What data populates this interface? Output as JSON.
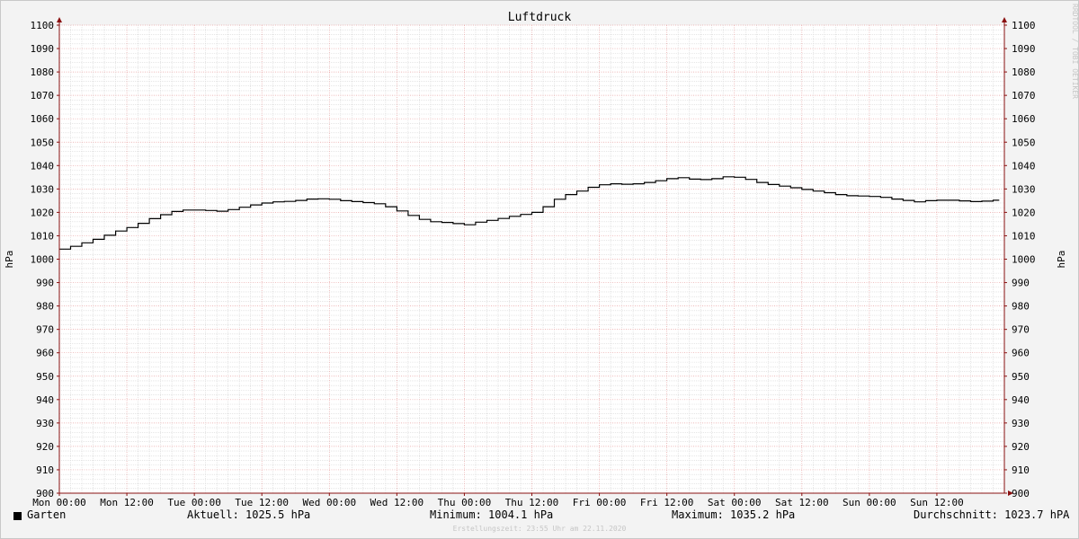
{
  "chart_data": {
    "type": "line",
    "title": "Luftdruck",
    "ylabel": "hPa",
    "ylabel_right": "hPa",
    "ylim": [
      900,
      1100
    ],
    "y_ticks": [
      900,
      910,
      920,
      930,
      940,
      950,
      960,
      970,
      980,
      990,
      1000,
      1010,
      1020,
      1030,
      1040,
      1050,
      1060,
      1070,
      1080,
      1090,
      1100
    ],
    "xlim": [
      0,
      168
    ],
    "x_ticks": [
      {
        "t": 0,
        "label": "Mon 00:00"
      },
      {
        "t": 12,
        "label": "Mon 12:00"
      },
      {
        "t": 24,
        "label": "Tue 00:00"
      },
      {
        "t": 36,
        "label": "Tue 12:00"
      },
      {
        "t": 48,
        "label": "Wed 00:00"
      },
      {
        "t": 60,
        "label": "Wed 12:00"
      },
      {
        "t": 72,
        "label": "Thu 00:00"
      },
      {
        "t": 84,
        "label": "Thu 12:00"
      },
      {
        "t": 96,
        "label": "Fri 00:00"
      },
      {
        "t": 108,
        "label": "Fri 12:00"
      },
      {
        "t": 120,
        "label": "Sat 00:00"
      },
      {
        "t": 132,
        "label": "Sat 12:00"
      },
      {
        "t": 144,
        "label": "Sun 00:00"
      },
      {
        "t": 156,
        "label": "Sun 12:00"
      }
    ],
    "grid": true,
    "series": [
      {
        "name": "Garten",
        "color": "#000000",
        "x": [
          0,
          2,
          4,
          6,
          8,
          10,
          12,
          14,
          16,
          18,
          20,
          22,
          24,
          26,
          28,
          30,
          32,
          34,
          36,
          38,
          40,
          42,
          44,
          46,
          48,
          50,
          52,
          54,
          56,
          58,
          60,
          62,
          64,
          66,
          68,
          70,
          72,
          74,
          76,
          78,
          80,
          82,
          84,
          86,
          88,
          90,
          92,
          94,
          96,
          98,
          100,
          102,
          104,
          106,
          108,
          110,
          112,
          114,
          116,
          118,
          120,
          122,
          124,
          126,
          128,
          130,
          132,
          134,
          136,
          138,
          140,
          142,
          144,
          146,
          148,
          150,
          152,
          154,
          156,
          158,
          160,
          162,
          164,
          166,
          167
        ],
        "y": [
          1004.3,
          1005.5,
          1007.0,
          1008.5,
          1010.2,
          1012.0,
          1013.5,
          1015.3,
          1017.3,
          1019.0,
          1020.4,
          1021.0,
          1021.0,
          1020.8,
          1020.5,
          1021.2,
          1022.2,
          1023.2,
          1024.0,
          1024.5,
          1024.7,
          1025.1,
          1025.7,
          1025.8,
          1025.6,
          1025.0,
          1024.6,
          1024.2,
          1023.7,
          1022.4,
          1020.6,
          1018.7,
          1017.0,
          1016.0,
          1015.7,
          1015.2,
          1014.7,
          1015.8,
          1016.6,
          1017.4,
          1018.3,
          1019.1,
          1020.0,
          1022.4,
          1025.6,
          1027.6,
          1029.1,
          1030.7,
          1031.8,
          1032.2,
          1032.0,
          1032.2,
          1032.8,
          1033.5,
          1034.4,
          1034.8,
          1034.2,
          1034.0,
          1034.4,
          1035.2,
          1035.0,
          1034.1,
          1032.8,
          1031.9,
          1031.2,
          1030.5,
          1029.8,
          1029.1,
          1028.4,
          1027.6,
          1027.1,
          1027.0,
          1026.8,
          1026.4,
          1025.7,
          1025.1,
          1024.5,
          1025.0,
          1025.2,
          1025.2,
          1024.9,
          1024.6,
          1024.8,
          1025.2,
          1025.4
        ]
      }
    ]
  },
  "legend": {
    "series_label": "Garten",
    "aktuell": "Aktuell: 1025.5 hPa",
    "minimum": "Minimum: 1004.1 hPa",
    "maximum": "Maximum: 1035.2 hPa",
    "durchschnitt": "Durchschnitt: 1023.7 hPA"
  },
  "footer": {
    "credit": "Erstellungszeit: 23:55 Uhr am 22.11.2020",
    "watermark": "RRDTOOL / TOBI OETIKER"
  },
  "colors": {
    "background": "#f3f3f3",
    "canvas": "#ffffff",
    "major_grid": "#e8a0a0",
    "minor_grid": "#d6d6d6",
    "axis": "#8a1010",
    "line": "#000000"
  }
}
